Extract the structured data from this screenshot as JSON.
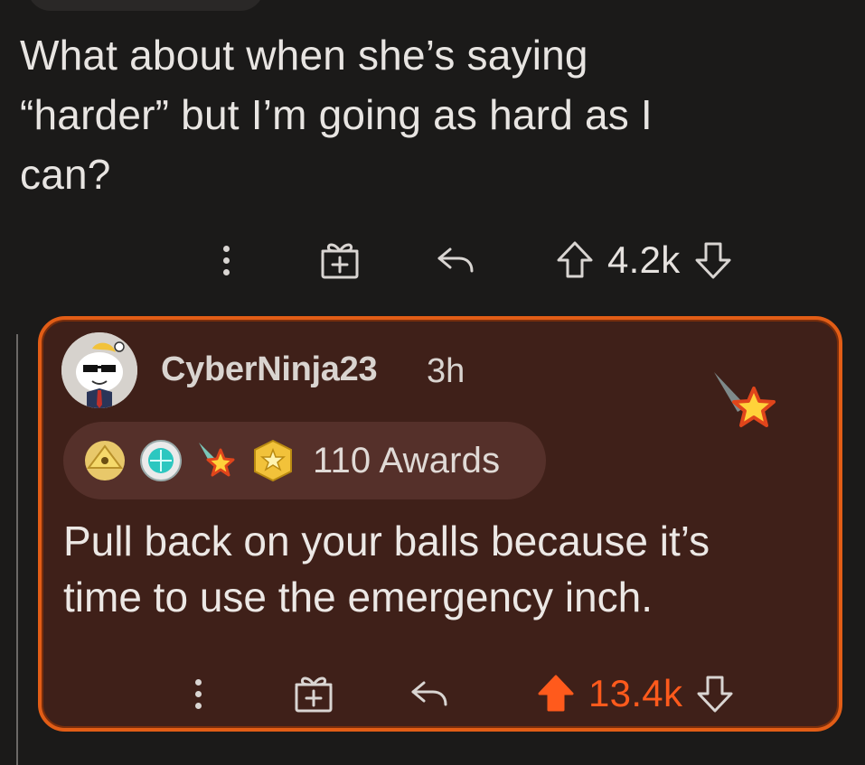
{
  "parent_comment": {
    "body": "What about when she’s saying\n“harder” but I’m going as hard as I\ncan?",
    "vote_count": "4.2k",
    "icons": [
      "more-options-icon",
      "gift-icon",
      "reply-icon",
      "upvote-icon",
      "downvote-icon"
    ]
  },
  "reply_comment": {
    "username": "CyberNinja23",
    "timestamp": "3h",
    "awards_label": "110 Awards",
    "award_icons": [
      "gold-pyramid-award-icon",
      "teal-gem-award-icon",
      "shooting-star-award-icon",
      "gold-star-award-icon"
    ],
    "body": "Pull back on your balls because it’s\ntime to use the emergency inch.",
    "vote_count": "13.4k",
    "upvoted": true,
    "icons": [
      "more-options-icon",
      "gift-icon",
      "reply-icon",
      "upvote-filled-icon",
      "downvote-icon"
    ]
  },
  "colors": {
    "background": "#1b1a19",
    "card_background": "#3f2019",
    "card_border": "#e25d16",
    "upvote_accent": "#ff5a1c",
    "text": "#e6e2df"
  }
}
